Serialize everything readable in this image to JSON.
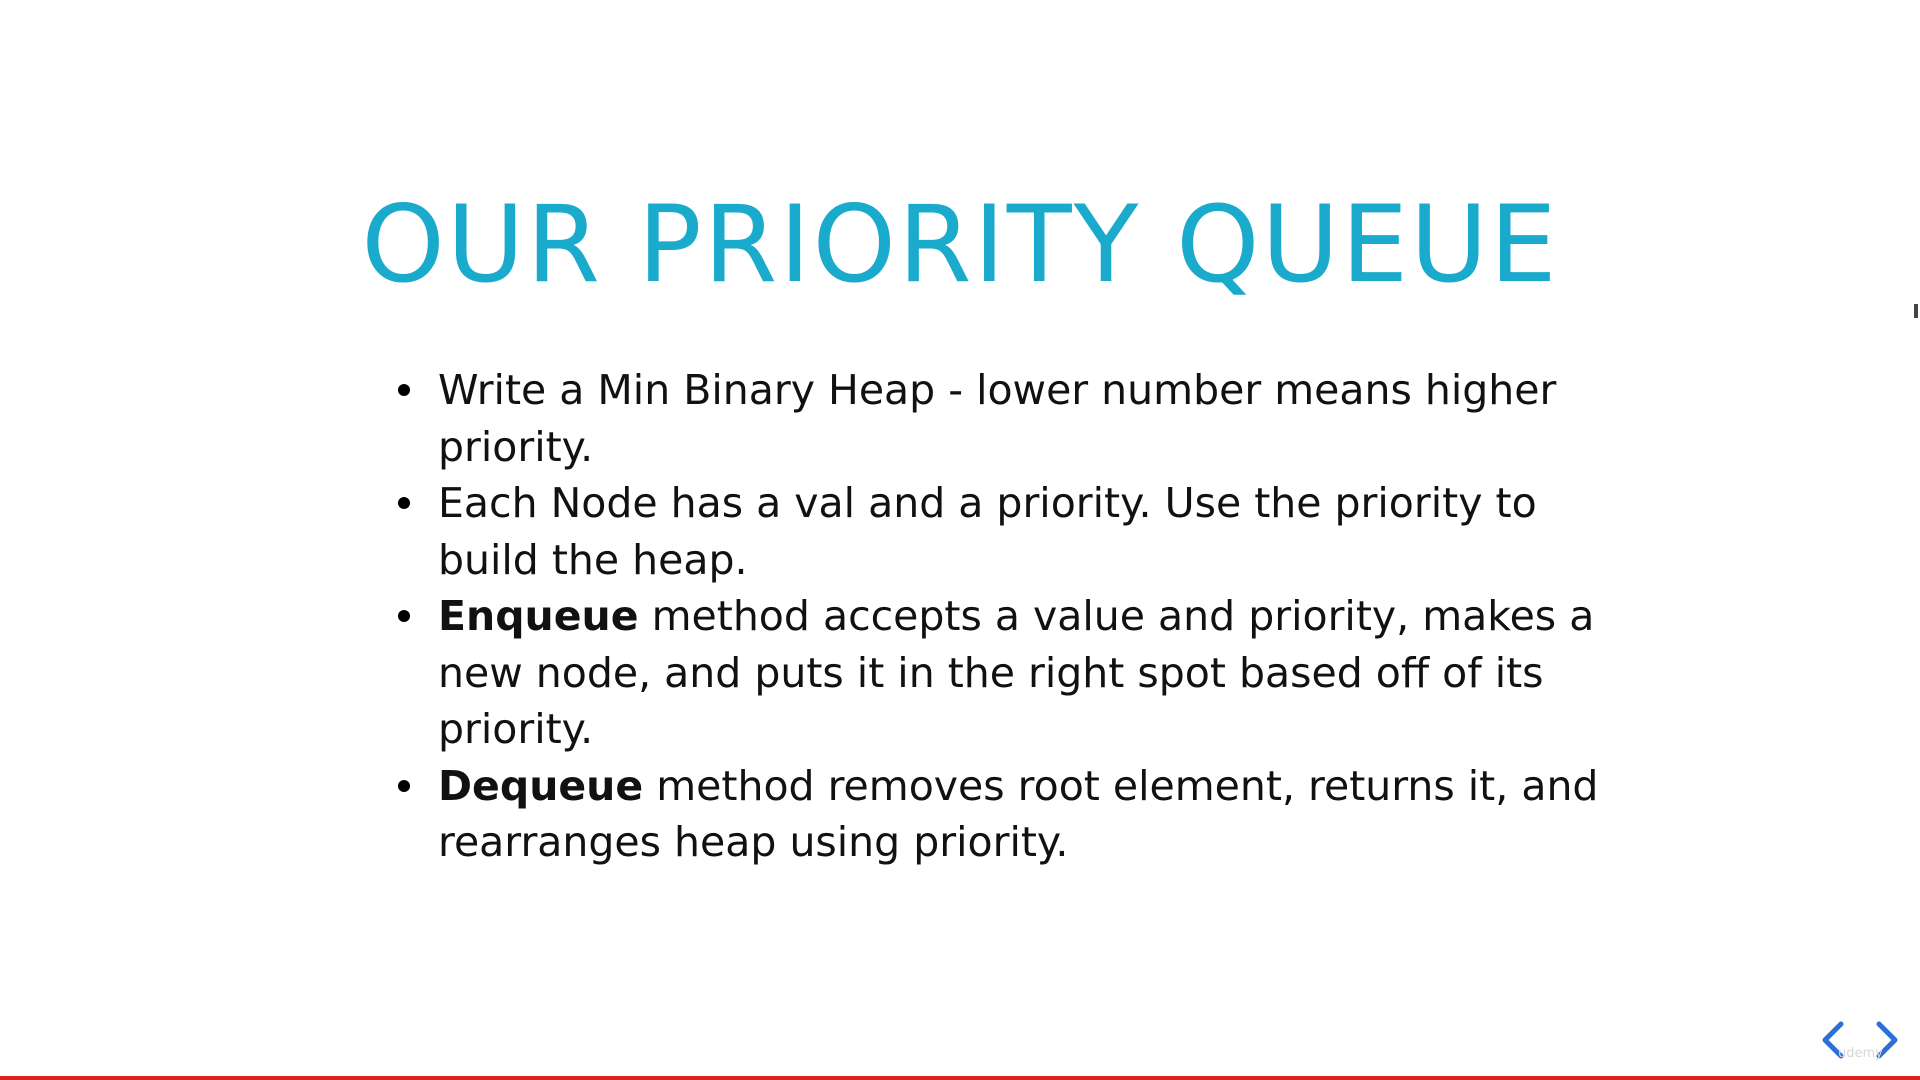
{
  "slide": {
    "title": "OUR PRIORITY QUEUE",
    "bullets": [
      {
        "lead": "",
        "text": "Write a Min Binary Heap - lower number means higher priority."
      },
      {
        "lead": "",
        "text": "Each Node has a val and a priority.  Use the priority to build the heap."
      },
      {
        "lead": "Enqueue",
        "text": " method accepts a value and priority, makes a new node, and puts it in the right spot based off of its priority."
      },
      {
        "lead": "Dequeue",
        "text": " method removes root element, returns it, and rearranges heap using priority."
      }
    ]
  },
  "navigation": {
    "prev_icon": "chevron-left-icon",
    "next_icon": "chevron-right-icon"
  },
  "watermark": {
    "text": "udemy"
  },
  "playback": {
    "progress_percent": 100
  },
  "colors": {
    "title": "#1aaacc",
    "body_text": "#111111",
    "nav_arrow": "#2b6fd6",
    "progress": "#dd2222"
  }
}
